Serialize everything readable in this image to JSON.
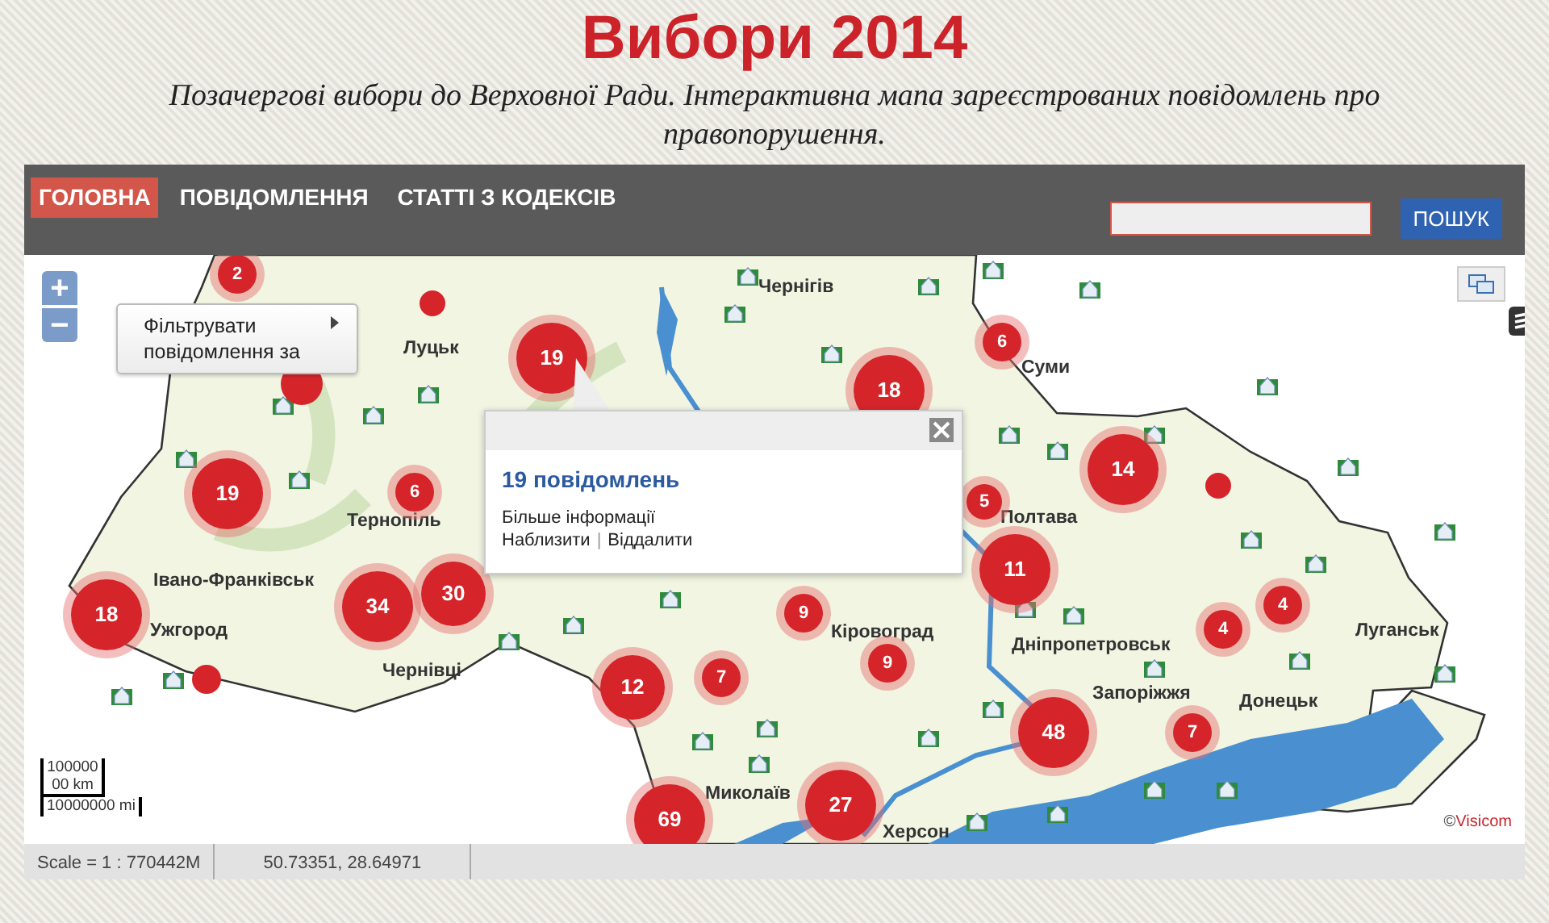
{
  "header": {
    "title": "Вибори 2014",
    "subtitle": "Позачергові вибори до Верховної Ради. Інтерактивна мапа зареєстрованих повідомлень про правопорушення."
  },
  "nav": {
    "tabs": [
      {
        "label": "ГОЛОВНА",
        "selected": true
      },
      {
        "label": "ПОВІДОМЛЕННЯ",
        "selected": false
      },
      {
        "label": "СТАТТІ З КОДЕКСІВ",
        "selected": false
      }
    ],
    "search": {
      "button": "ПОШУК"
    }
  },
  "map": {
    "zoom_in": "+",
    "zoom_out": "−",
    "filter_menu": "Фільтрувати повідомлення за",
    "cities": [
      "Чернігів",
      "Луцьк",
      "Суми",
      "Тернопіль",
      "Полтава",
      "Івано-Франківськ",
      "Ужгород",
      "Чернівці",
      "Кіровоград",
      "Дніпропетровськ",
      "Луганськ",
      "Донецьк",
      "Запоріжжя",
      "Миколаїв",
      "Херсон"
    ],
    "clusters": [
      {
        "kind": "count",
        "count": "2"
      },
      {
        "kind": "dot"
      },
      {
        "kind": "dot"
      },
      {
        "kind": "count",
        "count": "19"
      },
      {
        "kind": "count",
        "count": "18"
      },
      {
        "kind": "count",
        "count": "6"
      },
      {
        "kind": "count",
        "count": "14"
      },
      {
        "kind": "dot"
      },
      {
        "kind": "count",
        "count": "5"
      },
      {
        "kind": "count",
        "count": "19"
      },
      {
        "kind": "count",
        "count": "6"
      },
      {
        "kind": "count",
        "count": "30"
      },
      {
        "kind": "count",
        "count": "34"
      },
      {
        "kind": "count",
        "count": "18"
      },
      {
        "kind": "count",
        "count": "11"
      },
      {
        "kind": "count",
        "count": "9"
      },
      {
        "kind": "count",
        "count": "4"
      },
      {
        "kind": "count",
        "count": "4"
      },
      {
        "kind": "count",
        "count": "9"
      },
      {
        "kind": "count",
        "count": "7"
      },
      {
        "kind": "count",
        "count": "12"
      },
      {
        "kind": "count",
        "count": "48"
      },
      {
        "kind": "count",
        "count": "7"
      },
      {
        "kind": "count",
        "count": "27"
      },
      {
        "kind": "count",
        "count": "69"
      },
      {
        "kind": "dot"
      }
    ],
    "popup": {
      "title": "19 повідомлень",
      "more": "Більше інформації",
      "zoom_in": "Наблизити",
      "separator": "|",
      "zoom_out": "Віддалити"
    },
    "scale_bar": {
      "top": "10000000 km",
      "bottom": "10000000 mi"
    },
    "attribution": {
      "symbol": "©",
      "provider": "Visicom"
    }
  },
  "status_bar": {
    "scale": "Scale = 1 : 770442M",
    "coordinates": "50.73351, 28.64971"
  }
}
